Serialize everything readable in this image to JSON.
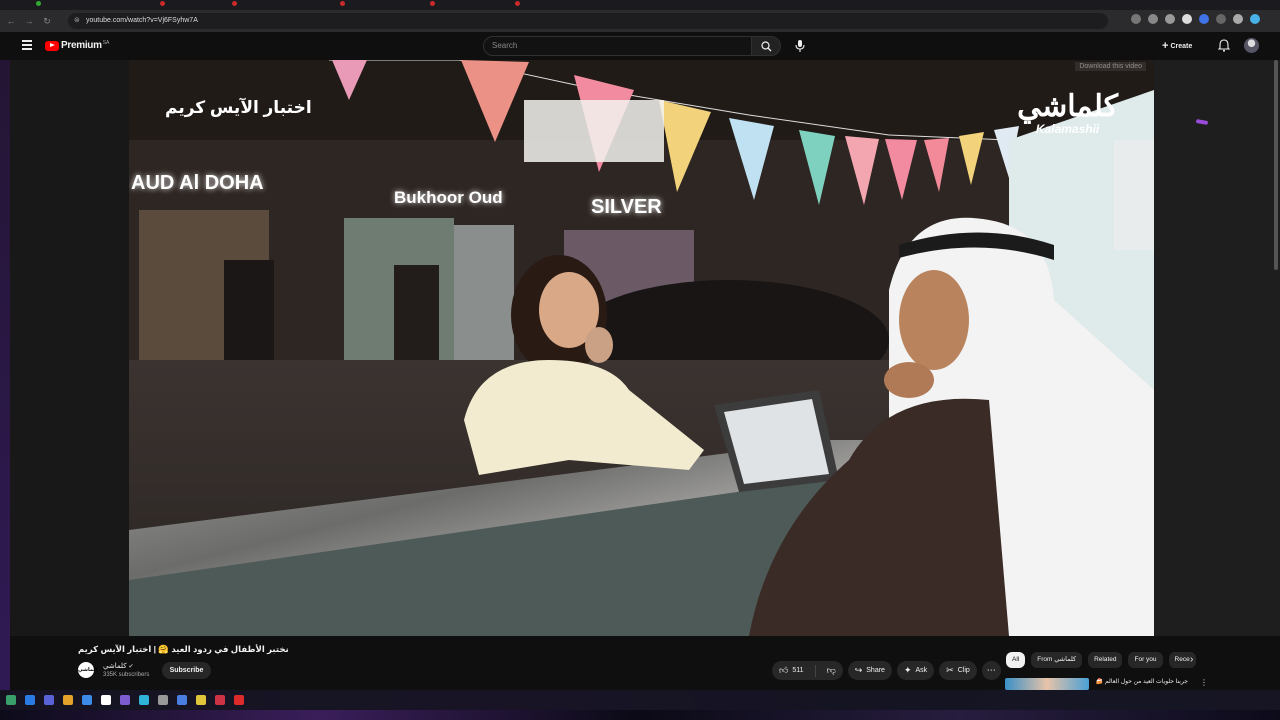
{
  "browser": {
    "url": "youtube.com/watch?v=Vj6FSyhw7A"
  },
  "header": {
    "brand": "Premium",
    "country_code": "SA",
    "search_placeholder": "Search",
    "create_label": "Create"
  },
  "video": {
    "overlay_title": "اختبار الآيس كريم",
    "logo_arabic": "كلماشي",
    "logo_english": "Kalamashii",
    "download_hint": "Download this video",
    "signs": [
      "AUD Al DOHA",
      "Bukhoor Oud",
      "SILVER"
    ]
  },
  "below": {
    "title": "نختبر الأطفال في ردود العيد 🤗 | اختبار الآيس كريم",
    "channel_name": "كلماشي",
    "channel_badge": "كلماشي",
    "subscribers": "335K subscribers",
    "subscribe_label": "Subscribe",
    "actions": {
      "like_count": "511",
      "share_label": "Share",
      "ask_label": "Ask",
      "clip_label": "Clip"
    },
    "chips": [
      "All",
      "From كلماشي",
      "Related",
      "For you",
      "Rece"
    ],
    "related_title": "جربنا حلويات العيد من حول العالم 🍰 |"
  },
  "colors": {
    "background": "#0f0f0f",
    "pill": "#272727",
    "brand_red": "#ff0000"
  }
}
